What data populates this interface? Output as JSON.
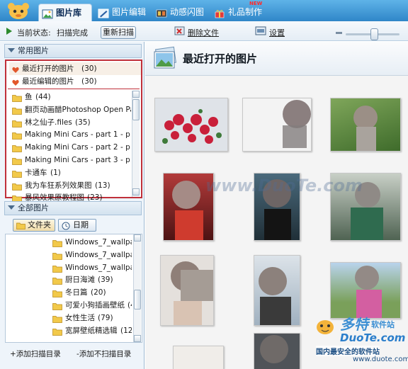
{
  "tabs": [
    {
      "label": "图片库",
      "active": true
    },
    {
      "label": "图片编辑",
      "active": false
    },
    {
      "label": "动感闪图",
      "active": false
    },
    {
      "label": "礼品制作",
      "active": false
    }
  ],
  "new_badge": "NEW",
  "toolbar": {
    "status_label": "当前状态:",
    "status_value": "扫描完成",
    "rescan_button": "重新扫描",
    "delete_files": "删除文件",
    "settings": "设置",
    "zoom_minus": "—"
  },
  "sidebar": {
    "common_header": "常用图片",
    "recent_items": [
      {
        "label": "最近打开的图片",
        "count": "(30)"
      },
      {
        "label": "最近编辑的图片",
        "count": "(30)"
      }
    ],
    "common_folders": [
      {
        "label": "鱼",
        "count": "(44)"
      },
      {
        "label": "翻页动画醋Photoshop Open Page",
        "count": ""
      },
      {
        "label": "林之仙子.files",
        "count": "(35)"
      },
      {
        "label": "Making Mini Cars - part 1 - p",
        "count": ""
      },
      {
        "label": "Making Mini Cars - part 2 - p",
        "count": ""
      },
      {
        "label": "Making Mini Cars - part 3 - p",
        "count": ""
      },
      {
        "label": "卡通车",
        "count": "(1)"
      },
      {
        "label": "我为车狂系列效果图",
        "count": "(13)"
      },
      {
        "label": "暴风效果原教程图",
        "count": "(23)"
      }
    ],
    "all_header": "全部图片",
    "view_tabs": {
      "folder": "文件夹",
      "date": "日期"
    },
    "all_folders": [
      {
        "label": "Windows_7_wallpape",
        "count": ""
      },
      {
        "label": "Windows_7_wallpape",
        "count": ""
      },
      {
        "label": "Windows_7_wallpape",
        "count": ""
      },
      {
        "label": "厨日海滩",
        "count": "(39)"
      },
      {
        "label": "冬日篇",
        "count": "(20)"
      },
      {
        "label": "可爱小狗插画壁纸",
        "count": "(4"
      },
      {
        "label": "女性生活",
        "count": "(79)"
      },
      {
        "label": "宽屏壁纸精选辑",
        "count": "(12"
      }
    ],
    "add_scan_dir": "+添加扫描目录",
    "add_noscan_dir": "-添加不扫描目录"
  },
  "main": {
    "title": "最近打开的图片"
  },
  "watermarks": {
    "center": "www.DuoTe.com",
    "brand_cn": "多特",
    "brand_cn2": "软件站",
    "brand_en": "DuoTe.com",
    "brand_tag": "国内最安全的软件站",
    "brand_url": "www.duote.com"
  },
  "colors": {
    "tab_bar": "#2f86c8",
    "highlight_box": "#c0303a",
    "panel_bg": "#eef4fa"
  }
}
